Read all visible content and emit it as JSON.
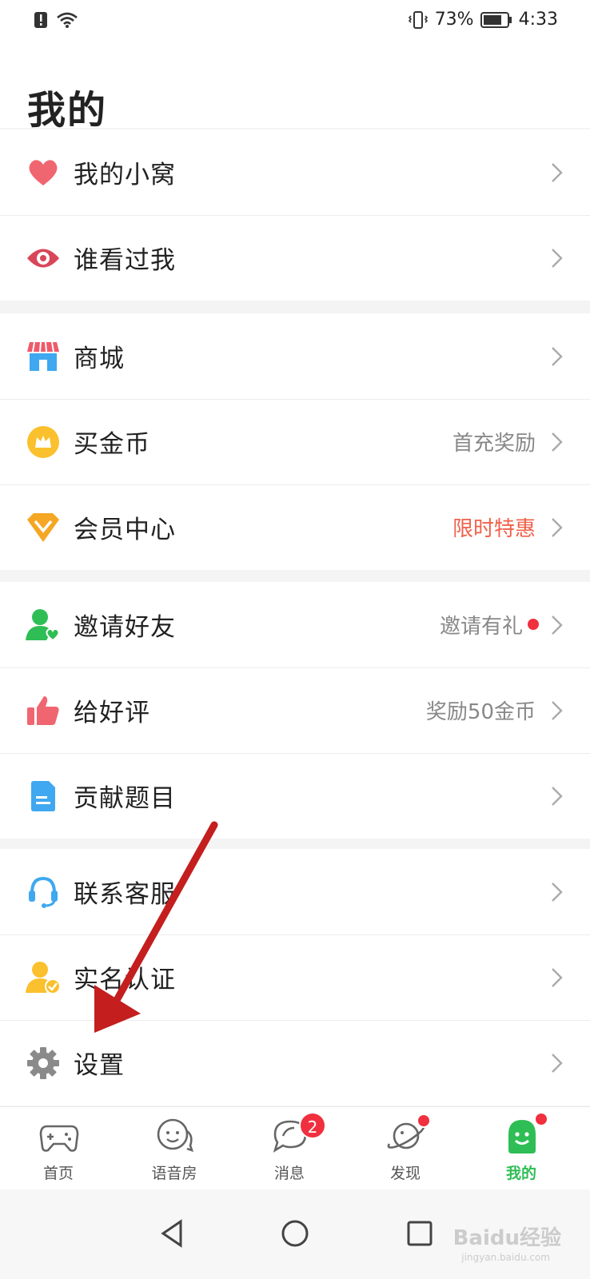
{
  "status_bar": {
    "battery_percent": "73%",
    "time": "4:33"
  },
  "header": {
    "title": "我的"
  },
  "groups": [
    {
      "items": [
        {
          "label": "我的小窝",
          "right": ""
        },
        {
          "label": "谁看过我",
          "right": ""
        }
      ]
    },
    {
      "items": [
        {
          "label": "商城",
          "right": ""
        },
        {
          "label": "买金币",
          "right": "首充奖励"
        },
        {
          "label": "会员中心",
          "right": "限时特惠"
        }
      ]
    },
    {
      "items": [
        {
          "label": "邀请好友",
          "right": "邀请有礼"
        },
        {
          "label": "给好评",
          "right": "奖励50金币"
        },
        {
          "label": "贡献题目",
          "right": ""
        }
      ]
    },
    {
      "items": [
        {
          "label": "联系客服",
          "right": ""
        },
        {
          "label": "实名认证",
          "right": ""
        },
        {
          "label": "设置",
          "right": ""
        }
      ]
    }
  ],
  "tabbar": {
    "tabs": [
      {
        "label": "首页"
      },
      {
        "label": "语音房"
      },
      {
        "label": "消息",
        "badge": "2"
      },
      {
        "label": "发现"
      },
      {
        "label": "我的"
      }
    ]
  },
  "colors": {
    "accent_green": "#2fbe55",
    "hot_red": "#f0614a",
    "badge_red": "#f0303e",
    "arrow_red": "#c41e1e"
  },
  "watermark": {
    "brand": "Baidu经验",
    "url": "jingyan.baidu.com"
  }
}
